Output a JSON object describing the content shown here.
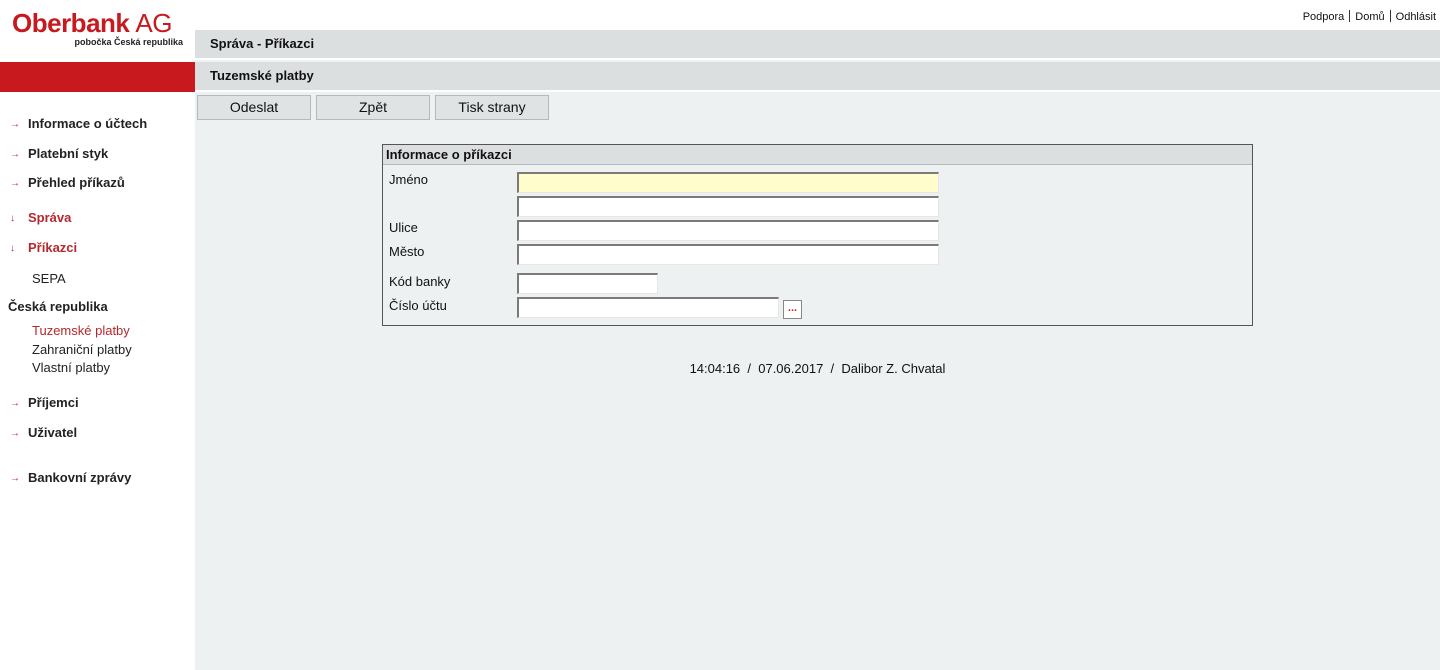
{
  "brand": {
    "name": "Oberbank",
    "suffix": "AG",
    "subtitle": "pobočka Česká republika"
  },
  "top_links": [
    "Podpora",
    "Domů",
    "Odhlásit"
  ],
  "header": {
    "section": "Správa - Příkazci",
    "subsection": "Tuzemské platby"
  },
  "buttons": {
    "send": "Odeslat",
    "back": "Zpět",
    "print": "Tisk strany"
  },
  "sidebar": {
    "info": "Informace o účtech",
    "payments": "Platební styk",
    "orders": "Přehled příkazů",
    "admin": "Správa",
    "payers": "Příkazci",
    "sepa": "SEPA",
    "country": "Česká republika",
    "domestic": "Tuzemské platby",
    "foreign": "Zahraniční platby",
    "own": "Vlastní platby",
    "recipients": "Příjemci",
    "user": "Uživatel",
    "bank_reports": "Bankovní zprávy",
    "arrow_right": "→",
    "arrow_down": "↓"
  },
  "form": {
    "title": "Informace o příkazci",
    "labels": {
      "name": "Jméno",
      "street": "Ulice",
      "city": "Město",
      "bank_code": "Kód banky",
      "account": "Číslo účtu"
    },
    "values": {
      "name1": "",
      "name2": "",
      "street": "",
      "city": "",
      "bank_code": "",
      "account": ""
    },
    "lookup": "..."
  },
  "footer": {
    "time": "14:04:16",
    "date": "07.06.2017",
    "user": "Dalibor Z. Chvatal"
  },
  "colors": {
    "brand_red": "#c8191f",
    "panel_bg": "#eef1f1",
    "header_bg": "#dcdfe0",
    "focus_bg": "#fffdcc"
  }
}
